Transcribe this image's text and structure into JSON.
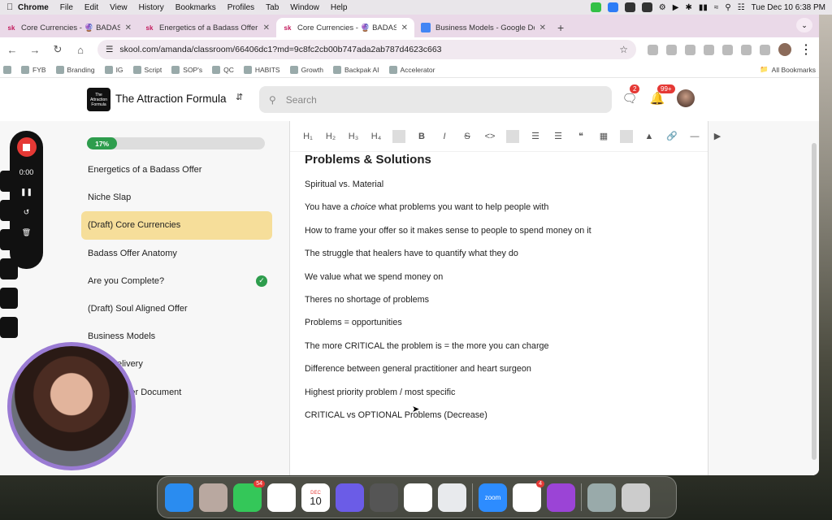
{
  "menubar": {
    "app": "Chrome",
    "items": [
      "File",
      "Edit",
      "View",
      "History",
      "Bookmarks",
      "Profiles",
      "Tab",
      "Window",
      "Help"
    ],
    "datetime": "Tue Dec 10  6:38 PM"
  },
  "tabs": [
    {
      "icon": "sk",
      "title": "Core Currencies - 🔮 BADASS"
    },
    {
      "icon": "sk",
      "title": "Energetics of a Badass Offer"
    },
    {
      "icon": "sk",
      "title": "Core Currencies - 🔮 BADASS"
    },
    {
      "icon": "doc",
      "title": "Business Models - Google Do"
    }
  ],
  "active_tab": 2,
  "url": "skool.com/amanda/classroom/66406dc1?md=9c8fc2cb00b747ada2ab787d4623c663",
  "bookmarks": [
    "FYB",
    "Branding",
    "IG",
    "Script",
    "SOP's",
    "QC",
    "HABITS",
    "Growth",
    "Backpak AI",
    "Accelerator"
  ],
  "bookmarks_all": "All Bookmarks",
  "site": {
    "logo_text": "The Attraction Formula",
    "brand": "The Attraction Formula",
    "search_placeholder": "Search",
    "chat_badge": "2",
    "notif_badge": "99+"
  },
  "course": {
    "progress_label": "17%",
    "progress_value": 17,
    "lessons": [
      {
        "title": "Energetics of a Badass Offer",
        "active": false,
        "done": false
      },
      {
        "title": "Niche Slap",
        "active": false,
        "done": false
      },
      {
        "title": "(Draft) Core Currencies",
        "active": true,
        "done": false
      },
      {
        "title": "Badass Offer Anatomy",
        "active": false,
        "done": false
      },
      {
        "title": "Are you Complete?",
        "active": false,
        "done": true
      },
      {
        "title": "(Draft) Soul Aligned Offer",
        "active": false,
        "done": false
      },
      {
        "title": "Business Models",
        "active": false,
        "done": false
      },
      {
        "title": "gram Delivery",
        "active": false,
        "done": false
      },
      {
        "title": "e Page Offer Document",
        "active": false,
        "done": false
      }
    ]
  },
  "editor": {
    "toolbar": [
      "H1",
      "H2",
      "H3",
      "H4",
      "B",
      "I",
      "S",
      "<>",
      "bullet-list",
      "numbered-list",
      "quote",
      "code-block",
      "image",
      "link",
      "divider",
      "video"
    ],
    "title": "Problems & Solutions",
    "lines": [
      "Spiritual vs. Material",
      "You have a choice what problems you want to help people with",
      "How to frame your offer so it makes sense to people to spend money on it",
      "The struggle that healers have to quantify what they do",
      "We value what we spend money on",
      "Theres no shortage of problems",
      "Problems = opportunities",
      "The more CRITICAL the problem is = the more you can charge",
      "Difference between general practitioner and heart surgeon",
      "Highest priority problem / most specific",
      "CRITICAL vs OPTIONAL Problems (Decrease)"
    ]
  },
  "recorder": {
    "time": "0:00"
  },
  "dock": {
    "apps": [
      "Finder",
      "Launchpad",
      "Messages",
      "Photos",
      "Calendar",
      "Elpass",
      "System Settings",
      "Muse",
      "Chrome",
      "Zoom",
      "Notion",
      "Podcasts",
      "Documents",
      "Trash"
    ],
    "messages_badge": "54",
    "notion_badge": "4",
    "calendar_month": "DEC",
    "calendar_day": "10",
    "zoom_label": "zoom"
  }
}
